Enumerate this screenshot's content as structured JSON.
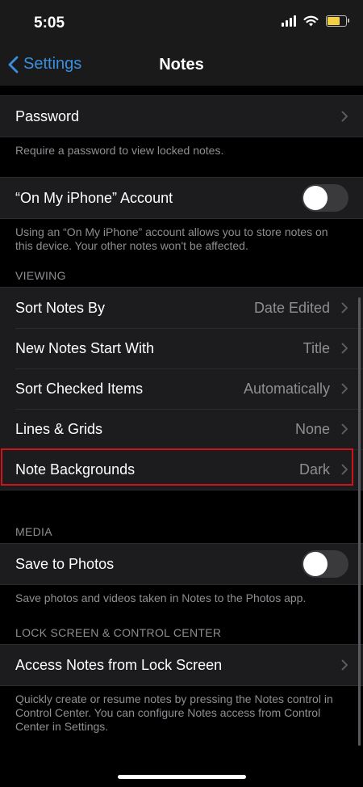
{
  "status": {
    "time": "5:05"
  },
  "nav": {
    "back_label": "Settings",
    "title": "Notes"
  },
  "password": {
    "label": "Password",
    "footer": "Require a password to view locked notes."
  },
  "account": {
    "label": "“On My iPhone” Account",
    "toggle_on": false,
    "footer": "Using an “On My iPhone” account allows you to store notes on this device. Your other notes won't be affected."
  },
  "viewing": {
    "header": "VIEWING",
    "rows": [
      {
        "label": "Sort Notes By",
        "value": "Date Edited"
      },
      {
        "label": "New Notes Start With",
        "value": "Title"
      },
      {
        "label": "Sort Checked Items",
        "value": "Automatically"
      },
      {
        "label": "Lines & Grids",
        "value": "None"
      },
      {
        "label": "Note Backgrounds",
        "value": "Dark"
      }
    ]
  },
  "media": {
    "header": "MEDIA",
    "label": "Save to Photos",
    "toggle_on": false,
    "footer": "Save photos and videos taken in Notes to the Photos app."
  },
  "lock": {
    "header": "LOCK SCREEN & CONTROL CENTER",
    "label": "Access Notes from Lock Screen",
    "footer": "Quickly create or resume notes by pressing the Notes control in Control Center. You can configure Notes access from Control Center in Settings."
  },
  "colors": {
    "accent": "#3a8fdf",
    "highlight": "#d0121b"
  }
}
